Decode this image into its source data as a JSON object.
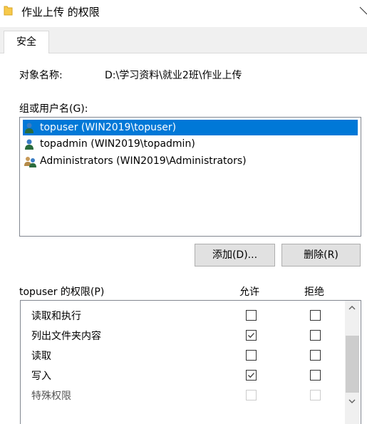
{
  "window": {
    "title": "作业上传 的权限",
    "close_icon": "close-icon"
  },
  "tabs": [
    {
      "label": "安全",
      "active": true
    }
  ],
  "object": {
    "label": "对象名称:",
    "path": "D:\\学习资料\\就业2班\\作业上传"
  },
  "groups": {
    "label": "组或用户名(G):",
    "items": [
      {
        "name": "topuser (WIN2019\\topuser)",
        "icon": "user-icon",
        "selected": true
      },
      {
        "name": "topadmin (WIN2019\\topadmin)",
        "icon": "user-icon",
        "selected": false
      },
      {
        "name": "Administrators (WIN2019\\Administrators)",
        "icon": "users-group-icon",
        "selected": false
      }
    ]
  },
  "buttons": {
    "add": "添加(D)...",
    "remove": "删除(R)"
  },
  "permissions": {
    "label": "topuser 的权限(P)",
    "allow_header": "允许",
    "deny_header": "拒绝",
    "rows": [
      {
        "name": "读取和执行",
        "allow": false,
        "deny": false,
        "disabled": false
      },
      {
        "name": "列出文件夹内容",
        "allow": true,
        "deny": false,
        "disabled": false
      },
      {
        "name": "读取",
        "allow": false,
        "deny": false,
        "disabled": false
      },
      {
        "name": "写入",
        "allow": true,
        "deny": false,
        "disabled": false
      },
      {
        "name": "特殊权限",
        "allow": false,
        "deny": false,
        "disabled": true
      }
    ]
  },
  "colors": {
    "selection": "#0078d7",
    "button_bg": "#e1e1e1",
    "folder": "#f7c94b"
  }
}
